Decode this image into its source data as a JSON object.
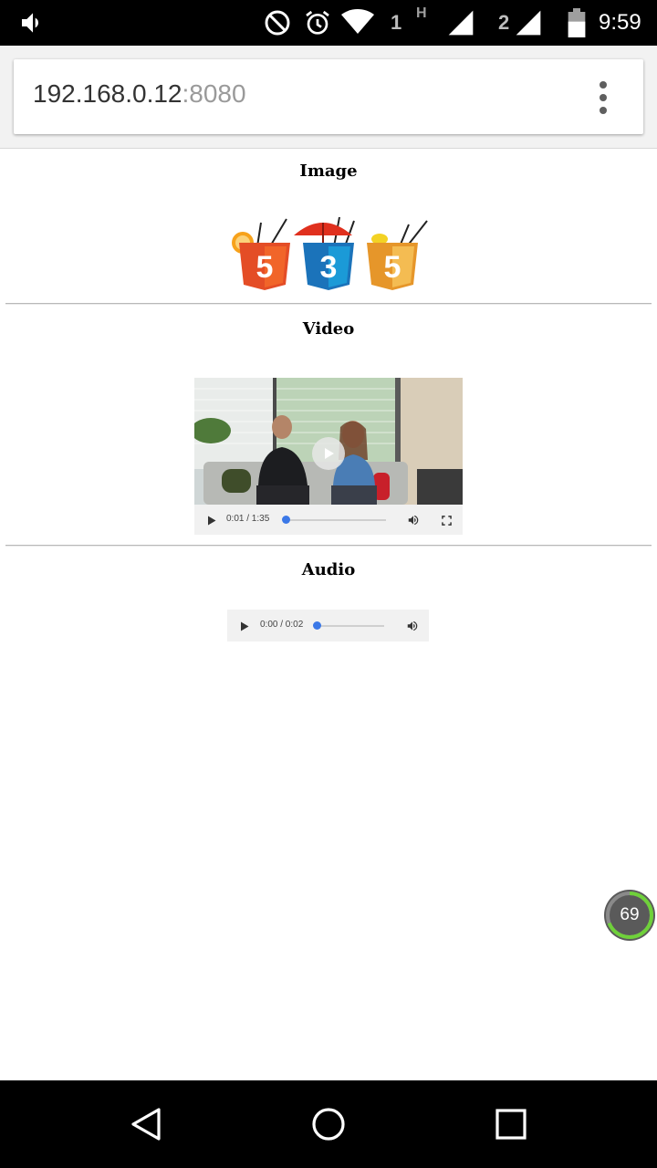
{
  "status_bar": {
    "time": "9:59",
    "sim1_label": "1",
    "sim1_network": "H",
    "sim2_label": "2",
    "icons": [
      "volume-icon",
      "do-not-disturb-icon",
      "alarm-icon",
      "wifi-icon",
      "signal-icon",
      "battery-icon"
    ]
  },
  "browser": {
    "url_host": "192.168.0.12",
    "url_port": ":8080",
    "menu_icon": "more-vert-icon"
  },
  "page": {
    "image_heading": "Image",
    "video_heading": "Video",
    "audio_heading": "Audio"
  },
  "video_player": {
    "time_display": "0:01 / 1:35",
    "progress": 0.01
  },
  "audio_player": {
    "time_display": "0:00 / 0:02",
    "progress": 0.0
  },
  "speed_badge": {
    "value": "69",
    "ring_color": "#6fd13a"
  },
  "colors": {
    "accent_blue": "#3b78e7",
    "html5_orange": "#e44d26",
    "css3_blue": "#1b9ad7",
    "js_yellow": "#f0a93c"
  }
}
